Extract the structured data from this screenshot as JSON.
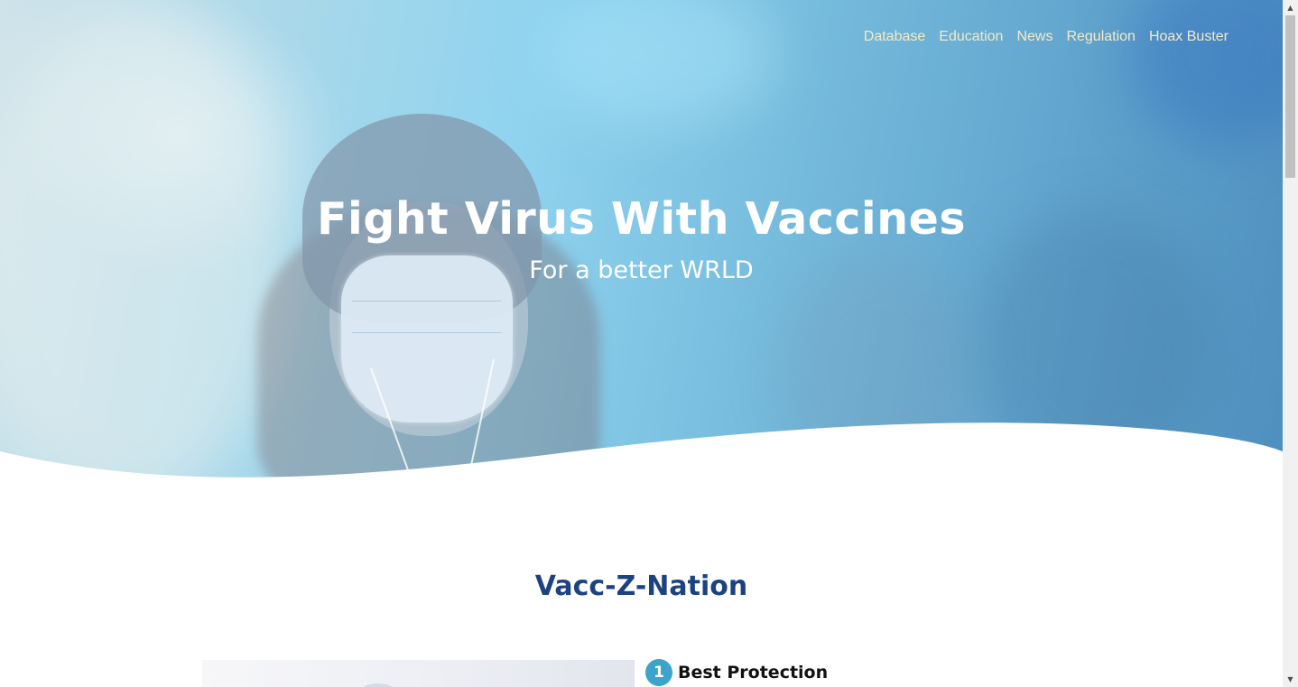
{
  "nav": {
    "items": [
      "Database",
      "Education",
      "News",
      "Regulation",
      "Hoax Buster"
    ]
  },
  "hero": {
    "title": "Fight Virus With Vaccines",
    "subtitle": "For a better WRLD"
  },
  "section": {
    "title": "Vacc-Z-Nation"
  },
  "features": [
    {
      "number": "1",
      "label": "Best Protection"
    }
  ],
  "scrollbar": {
    "up": "▲",
    "down": "▼"
  },
  "colors": {
    "nav_text": "#f4e9c6",
    "section_title": "#1d4280",
    "number_badge": "#3ba3cc"
  }
}
